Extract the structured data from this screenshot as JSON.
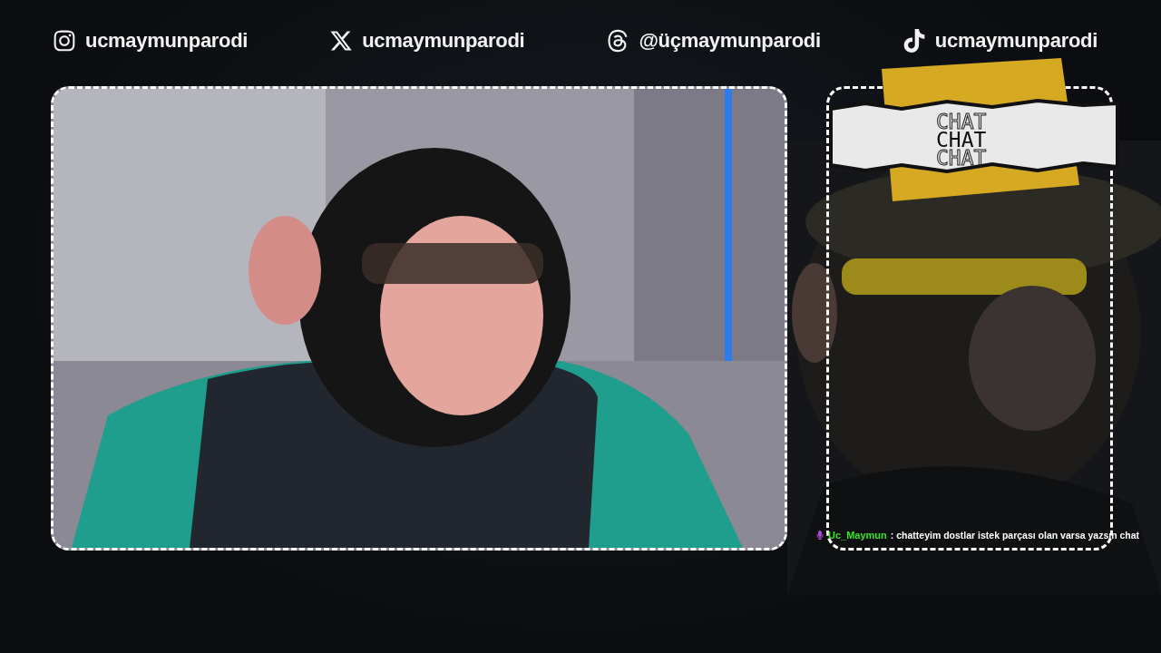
{
  "social_links": [
    {
      "kind": "instagram",
      "handle": "ucmaymunparodi"
    },
    {
      "kind": "x",
      "handle": "ucmaymunparodi"
    },
    {
      "kind": "threads",
      "handle": "@üçmaymunparodi"
    },
    {
      "kind": "tiktok",
      "handle": "ucmaymunparodi"
    }
  ],
  "chat": {
    "title_lines": [
      {
        "text": "CHAT",
        "kind": "outline"
      },
      {
        "text": "CHAT",
        "kind": "solid"
      },
      {
        "text": "CHAT",
        "kind": "outline"
      }
    ],
    "messages": [
      {
        "user": "Uc_Maymun",
        "text": ": chatteyim dostlar istek parçası olan varsa yazsın chat"
      }
    ]
  }
}
